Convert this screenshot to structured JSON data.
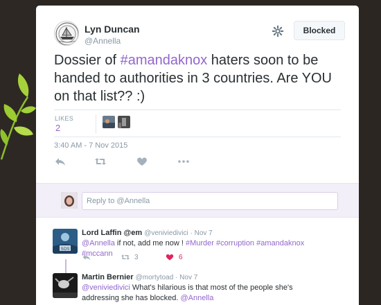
{
  "colors": {
    "accent": "#9266cc",
    "heart": "#e0245e",
    "text": "#292f33",
    "muted": "#8899a6",
    "reply_bg": "#f3eff9"
  },
  "tweet": {
    "author_name": "Lyn Duncan",
    "author_handle": "@Annella",
    "blocked_label": "Blocked",
    "text_before": "Dossier of ",
    "hashtag": "#amandaknox",
    "text_after": " haters soon to be handed to authorities in 3 countries. Are YOU on that list??  :)",
    "likes_label": "LIKES",
    "likes_count": "2",
    "timestamp": "3:40 AM - 7 Nov 2015"
  },
  "reply_box": {
    "placeholder": "Reply to @Annella"
  },
  "replies": [
    {
      "name": "Lord Laffin @em",
      "handle": "@veniviedivici",
      "date": "Nov 7",
      "mention": "@Annella",
      "text": " if not, add me now ! ",
      "hashtags": "#Murder #corruption #amandaknox #mccann",
      "retweets": "3",
      "likes": "6",
      "avatar_label": "SOS"
    },
    {
      "name": "Martin Bernier",
      "handle": "@mortytoad",
      "date": "Nov 7",
      "mention": "@veniviedivici",
      "text": " What's hilarious is that most of the people she's addressing she has blocked.  ",
      "mention2": "@Annella"
    }
  ],
  "icons": {
    "settings": "gear-icon",
    "reply": "reply-icon",
    "retweet": "retweet-icon",
    "like": "heart-icon",
    "more": "more-icon"
  }
}
